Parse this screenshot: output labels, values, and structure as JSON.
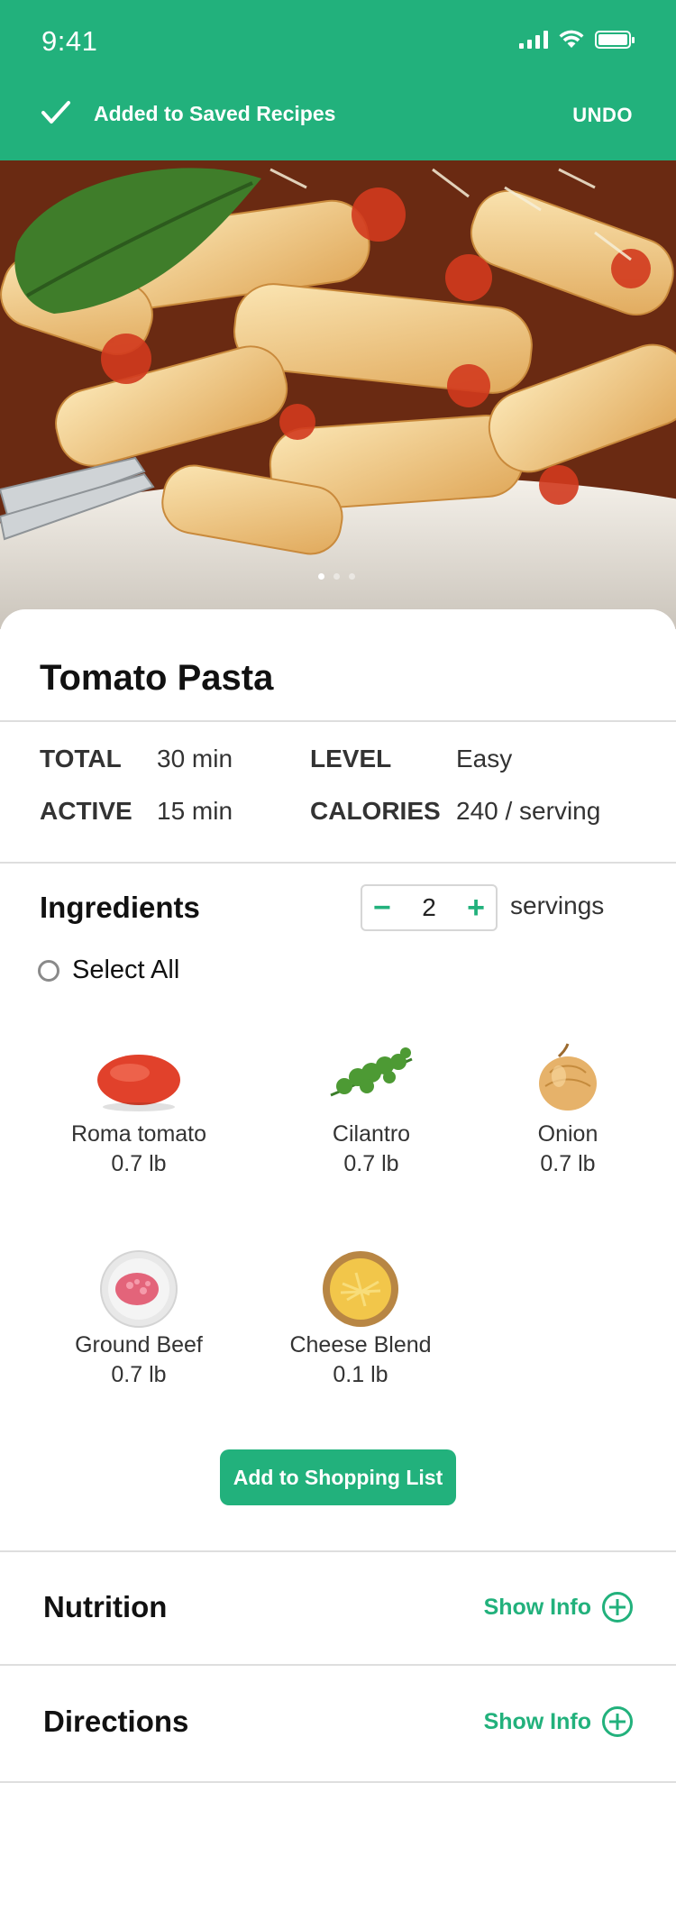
{
  "status_bar": {
    "time": "9:41"
  },
  "toast": {
    "message": "Added to Saved Recipes",
    "undo_label": "UNDO"
  },
  "hero": {
    "page_dots": 3,
    "active_dot": 0
  },
  "recipe": {
    "title": "Tomato Pasta",
    "stats": {
      "total_label": "TOTAL",
      "total_value": "30 min",
      "active_label": "ACTIVE",
      "active_value": "15 min",
      "level_label": "LEVEL",
      "level_value": "Easy",
      "calories_label": "CALORIES",
      "calories_value": "240 / serving"
    }
  },
  "ingredients": {
    "title": "Ingredients",
    "servings_count": "2",
    "servings_label": "servings",
    "select_all_label": "Select All",
    "items": [
      {
        "name": "Roma tomato",
        "qty": "0.7 lb",
        "icon": "tomato-icon"
      },
      {
        "name": "Cilantro",
        "qty": "0.7 lb",
        "icon": "cilantro-icon"
      },
      {
        "name": "Onion",
        "qty": "0.7 lb",
        "icon": "onion-icon"
      },
      {
        "name": "Ground Beef",
        "qty": "0.7 lb",
        "icon": "ground-beef-icon"
      },
      {
        "name": "Cheese Blend",
        "qty": "0.1 lb",
        "icon": "cheese-icon"
      }
    ],
    "add_button_label": "Add to Shopping List"
  },
  "sections": {
    "nutrition": {
      "title": "Nutrition",
      "action": "Show Info"
    },
    "directions": {
      "title": "Directions",
      "action": "Show Info"
    }
  },
  "colors": {
    "accent": "#22b17c"
  }
}
